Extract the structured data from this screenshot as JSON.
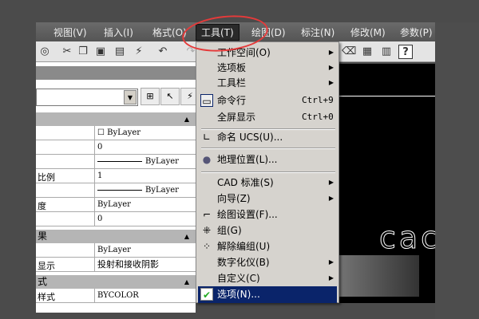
{
  "menubar": {
    "items": [
      "视图(V)",
      "插入(I)",
      "格式(O)",
      "工具(T)",
      "绘图(D)",
      "标注(N)",
      "修改(M)",
      "参数(P)"
    ],
    "active": "工具(T)"
  },
  "toolbar": {
    "icons": [
      "cloud-icon",
      "cut-icon",
      "copy-icon",
      "paste-icon",
      "match-properties-icon",
      "block-edit-icon",
      "undo-icon",
      "redo-icon",
      "properties-icon",
      "eraser-icon",
      "sheet-set-icon",
      "calculator-icon",
      "help-icon"
    ]
  },
  "properties": {
    "sections": [
      {
        "label": "",
        "rows": [
          [
            "",
            "☐ ByLayer"
          ],
          [
            "",
            "0"
          ],
          [
            "",
            "ByLayer"
          ],
          [
            "比例",
            "1"
          ],
          [
            "",
            "ByLayer"
          ],
          [
            "度",
            "ByLayer"
          ],
          [
            "",
            "0"
          ]
        ]
      },
      {
        "label": "果",
        "rows": [
          [
            "",
            "ByLayer"
          ],
          [
            "显示",
            "投射和接收阴影"
          ]
        ]
      },
      {
        "label": "式",
        "rows": [
          [
            "样式",
            "BYCOLOR"
          ]
        ]
      }
    ]
  },
  "tools_menu": {
    "items": [
      {
        "label": "工作空间(O)",
        "submenu": true
      },
      {
        "label": "选项板",
        "submenu": true
      },
      {
        "label": "工具栏",
        "submenu": true
      },
      {
        "label": "命令行",
        "shortcut": "Ctrl+9",
        "icon": "command-line-icon"
      },
      {
        "label": "全屏显示",
        "shortcut": "Ctrl+0"
      },
      {
        "label": "命名 UCS(U)...",
        "icon": "ucs-icon"
      },
      {
        "label": "地理位置(L)...",
        "icon": "globe-icon"
      },
      {
        "label": "CAD 标准(S)",
        "submenu": true
      },
      {
        "label": "向导(Z)",
        "submenu": true
      },
      {
        "label": "绘图设置(F)...",
        "icon": "drafting-settings-icon"
      },
      {
        "label": "组(G)",
        "icon": "group-icon"
      },
      {
        "label": "解除编组(U)",
        "icon": "ungroup-icon"
      },
      {
        "label": "数字化仪(B)",
        "submenu": true
      },
      {
        "label": "自定义(C)",
        "submenu": true
      },
      {
        "label": "选项(N)...",
        "icon": "options-check-icon",
        "highlighted": true
      }
    ]
  },
  "canvas": {
    "text": "cac"
  },
  "colors": {
    "highlight": "#0a246a",
    "annotation": "#e53a3a"
  }
}
